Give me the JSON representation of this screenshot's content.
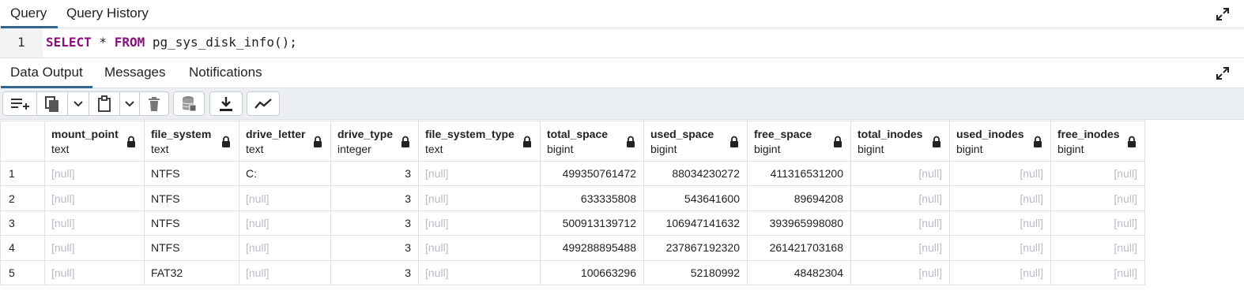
{
  "query_tabs": [
    {
      "label": "Query",
      "active": true
    },
    {
      "label": "Query History",
      "active": false
    }
  ],
  "editor": {
    "line_number": "1",
    "tokens": [
      {
        "text": "SELECT",
        "kind": "keyword"
      },
      {
        "text": " * ",
        "kind": "text"
      },
      {
        "text": "FROM",
        "kind": "keyword"
      },
      {
        "text": " pg_sys_disk_info();",
        "kind": "text"
      }
    ]
  },
  "output_tabs": [
    {
      "label": "Data Output",
      "active": true
    },
    {
      "label": "Messages",
      "active": false
    },
    {
      "label": "Notifications",
      "active": false
    }
  ],
  "toolbar_icons": [
    "add-row-icon",
    "copy-icon",
    "chevron-down-icon",
    "paste-icon",
    "chevron-down-icon",
    "delete-icon",
    "save-data-icon",
    "download-icon",
    "graph-visualiser-icon"
  ],
  "colors": {
    "accent": "#326690",
    "keyword": "#8a0f7f",
    "null_text": "#b8bcc2",
    "toolbar_bg": "#ebeef3"
  },
  "grid": {
    "null_text": "[null]",
    "columns": [
      {
        "name": "mount_point",
        "type": "text",
        "align": "left"
      },
      {
        "name": "file_system",
        "type": "text",
        "align": "left"
      },
      {
        "name": "drive_letter",
        "type": "text",
        "align": "left"
      },
      {
        "name": "drive_type",
        "type": "integer",
        "align": "right"
      },
      {
        "name": "file_system_type",
        "type": "text",
        "align": "left"
      },
      {
        "name": "total_space",
        "type": "bigint",
        "align": "right"
      },
      {
        "name": "used_space",
        "type": "bigint",
        "align": "right"
      },
      {
        "name": "free_space",
        "type": "bigint",
        "align": "right"
      },
      {
        "name": "total_inodes",
        "type": "bigint",
        "align": "right"
      },
      {
        "name": "used_inodes",
        "type": "bigint",
        "align": "right"
      },
      {
        "name": "free_inodes",
        "type": "bigint",
        "align": "right"
      }
    ],
    "rows": [
      {
        "num": "1",
        "cells": [
          null,
          "NTFS",
          "C:",
          "3",
          null,
          "499350761472",
          "88034230272",
          "411316531200",
          null,
          null,
          null
        ]
      },
      {
        "num": "2",
        "cells": [
          null,
          "NTFS",
          null,
          "3",
          null,
          "633335808",
          "543641600",
          "89694208",
          null,
          null,
          null
        ]
      },
      {
        "num": "3",
        "cells": [
          null,
          "NTFS",
          null,
          "3",
          null,
          "500913139712",
          "106947141632",
          "393965998080",
          null,
          null,
          null
        ]
      },
      {
        "num": "4",
        "cells": [
          null,
          "NTFS",
          null,
          "3",
          null,
          "499288895488",
          "237867192320",
          "261421703168",
          null,
          null,
          null
        ]
      },
      {
        "num": "5",
        "cells": [
          null,
          "FAT32",
          null,
          "3",
          null,
          "100663296",
          "52180992",
          "48482304",
          null,
          null,
          null
        ]
      }
    ]
  }
}
